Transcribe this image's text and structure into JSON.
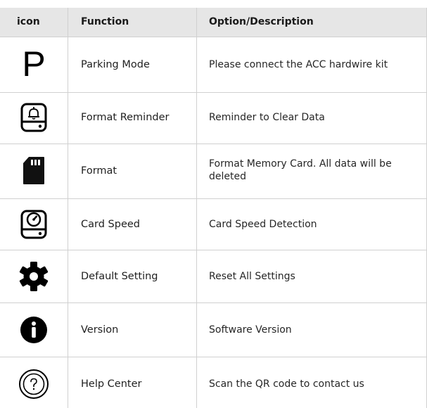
{
  "table": {
    "headers": {
      "icon": "icon",
      "function": "Function",
      "description": "Option/Description"
    },
    "rows": [
      {
        "icon": "parking-p-icon",
        "icon_text": "P",
        "function": "Parking Mode",
        "description": "Please connect the ACC hardwire kit"
      },
      {
        "icon": "format-reminder-bell-icon",
        "function": "Format Reminder",
        "description": "Reminder to Clear Data"
      },
      {
        "icon": "sd-card-icon",
        "function": "Format",
        "description": "Format Memory Card. All data will be deleted"
      },
      {
        "icon": "card-speed-gauge-icon",
        "function": "Card Speed",
        "description": "Card Speed Detection"
      },
      {
        "icon": "gear-icon",
        "function": "Default Setting",
        "description": "Reset All Settings"
      },
      {
        "icon": "info-icon",
        "function": "Version",
        "description": "Software Version"
      },
      {
        "icon": "help-question-icon",
        "function": "Help Center",
        "description": "Scan the QR code to contact us"
      }
    ]
  }
}
